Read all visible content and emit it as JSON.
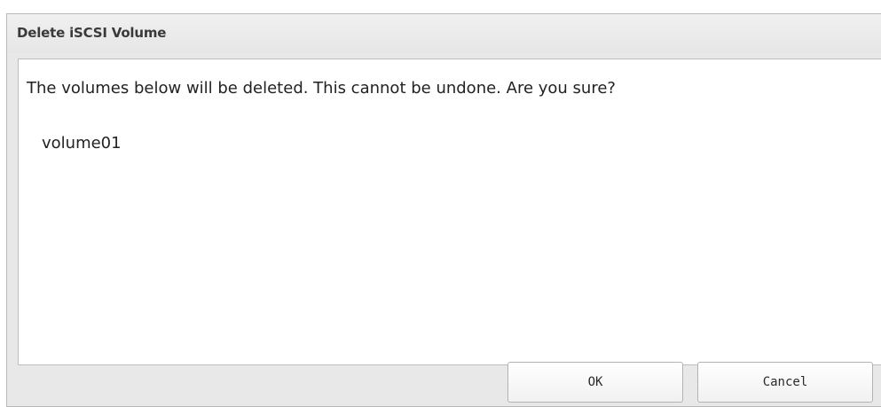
{
  "dialog": {
    "title": "Delete iSCSI Volume",
    "message": "The volumes below will be deleted. This cannot be undone. Are you sure?",
    "volumes": [
      "volume01"
    ],
    "buttons": {
      "ok_label": "OK",
      "cancel_label": "Cancel"
    }
  }
}
